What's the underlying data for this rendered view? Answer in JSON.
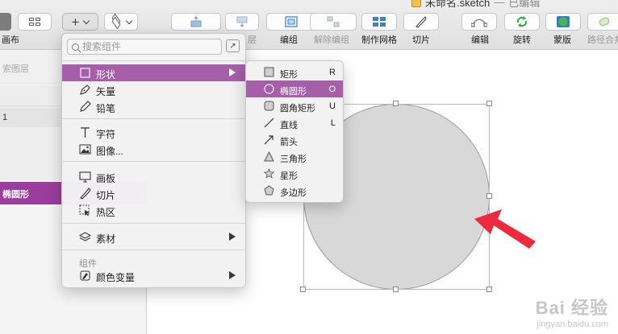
{
  "window": {
    "title": "未命名.sketch",
    "separator": "—",
    "edited": "已编辑"
  },
  "toolbar": {
    "canvas_label": "画布",
    "layer_suffix": "层",
    "group": "编组",
    "ungroup": "解除编组",
    "make_grid": "制作网格",
    "slice": "切片",
    "edit": "编辑",
    "rotate": "旋转",
    "mask": "蒙版",
    "path_combine": "路径合并"
  },
  "layers_panel": {
    "search_placeholder": "索图层",
    "row_page": "1",
    "selected_layer": "椭圆形"
  },
  "insert_menu": {
    "search_placeholder": "搜索组件",
    "items": [
      {
        "label": "形状",
        "icon": "square-icon",
        "submenu": true
      },
      {
        "label": "矢量",
        "icon": "pen-tool-icon"
      },
      {
        "label": "铅笔",
        "icon": "pencil-icon"
      },
      {
        "label": "字符",
        "icon": "text-icon"
      },
      {
        "label": "图像...",
        "icon": "image-icon"
      },
      {
        "label": "画板",
        "icon": "artboard-icon"
      },
      {
        "label": "切片",
        "icon": "slice-knife-icon"
      },
      {
        "label": "热区",
        "icon": "hotspot-icon"
      },
      {
        "label": "素材",
        "icon": "layers-stack-icon",
        "submenu": true
      },
      {
        "label": "颜色变量",
        "icon": "color-variable-icon",
        "submenu": true
      }
    ],
    "group_label": "组件"
  },
  "shape_submenu": {
    "items": [
      {
        "label": "矩形",
        "key": "R",
        "icon": "rectangle-icon"
      },
      {
        "label": "椭圆形",
        "key": "O",
        "icon": "oval-icon"
      },
      {
        "label": "圆角矩形",
        "key": "U",
        "icon": "rounded-rectangle-icon"
      },
      {
        "label": "直线",
        "key": "L",
        "icon": "line-icon"
      },
      {
        "label": "箭头",
        "key": "",
        "icon": "arrow-icon"
      },
      {
        "label": "三角形",
        "key": "",
        "icon": "triangle-icon"
      },
      {
        "label": "星形",
        "key": "",
        "icon": "star-icon"
      },
      {
        "label": "多边形",
        "key": "",
        "icon": "polygon-icon"
      }
    ]
  },
  "watermark": {
    "brand": "Bai 经验",
    "url": "jingyan.baidu.com"
  },
  "colors": {
    "accent": "#a55fa9",
    "selected_layer": "#9a3d9c",
    "arrow": "#f0283c",
    "shape_fill": "#d8d8d8"
  }
}
